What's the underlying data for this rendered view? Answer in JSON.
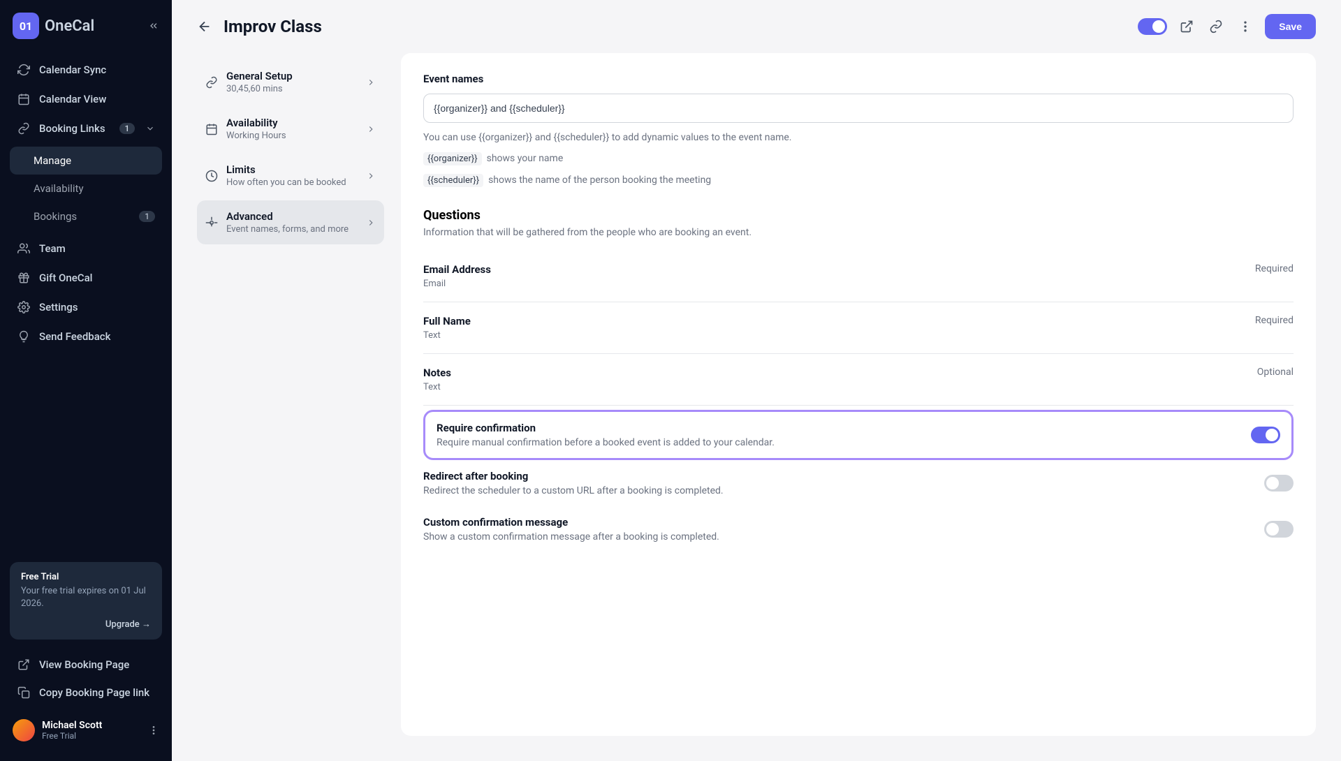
{
  "brand": {
    "short": "01",
    "name": "OneCal"
  },
  "sidebar": {
    "items": [
      {
        "label": "Calendar Sync"
      },
      {
        "label": "Calendar View"
      },
      {
        "label": "Booking Links",
        "badge": "1"
      }
    ],
    "sub": [
      {
        "label": "Manage"
      },
      {
        "label": "Availability"
      },
      {
        "label": "Bookings",
        "badge": "1"
      }
    ],
    "items2": [
      {
        "label": "Team"
      },
      {
        "label": "Gift OneCal"
      },
      {
        "label": "Settings"
      },
      {
        "label": "Send Feedback"
      }
    ],
    "bottom": [
      {
        "label": "View Booking Page"
      },
      {
        "label": "Copy Booking Page link"
      }
    ]
  },
  "trial": {
    "title": "Free Trial",
    "text": "Your free trial expires on 01 Jul 2026.",
    "cta": "Upgrade →"
  },
  "user": {
    "name": "Michael Scott",
    "plan": "Free Trial"
  },
  "header": {
    "title": "Improv Class",
    "save": "Save"
  },
  "config": [
    {
      "label": "General Setup",
      "sub": "30,45,60 mins"
    },
    {
      "label": "Availability",
      "sub": "Working Hours"
    },
    {
      "label": "Limits",
      "sub": "How often you can be booked"
    },
    {
      "label": "Advanced",
      "sub": "Event names, forms, and more"
    }
  ],
  "panel": {
    "eventNames": {
      "title": "Event names",
      "value": "{{organizer}} and {{scheduler}}",
      "helper": "You can use {{organizer}} and {{scheduler}} to add dynamic values to the event name.",
      "var1": "{{organizer}}",
      "var1desc": "shows your name",
      "var2": "{{scheduler}}",
      "var2desc": "shows the name of the person booking the meeting"
    },
    "questions": {
      "title": "Questions",
      "sub": "Information that will be gathered from the people who are booking an event."
    },
    "q": [
      {
        "name": "Email Address",
        "type": "Email",
        "req": "Required"
      },
      {
        "name": "Full Name",
        "type": "Text",
        "req": "Required"
      },
      {
        "name": "Notes",
        "type": "Text",
        "req": "Optional"
      }
    ],
    "settings": [
      {
        "title": "Require confirmation",
        "desc": "Require manual confirmation before a booked event is added to your calendar.",
        "on": true,
        "highlight": true
      },
      {
        "title": "Redirect after booking",
        "desc": "Redirect the scheduler to a custom URL after a booking is completed.",
        "on": false
      },
      {
        "title": "Custom confirmation message",
        "desc": "Show a custom confirmation message after a booking is completed.",
        "on": false
      }
    ]
  }
}
